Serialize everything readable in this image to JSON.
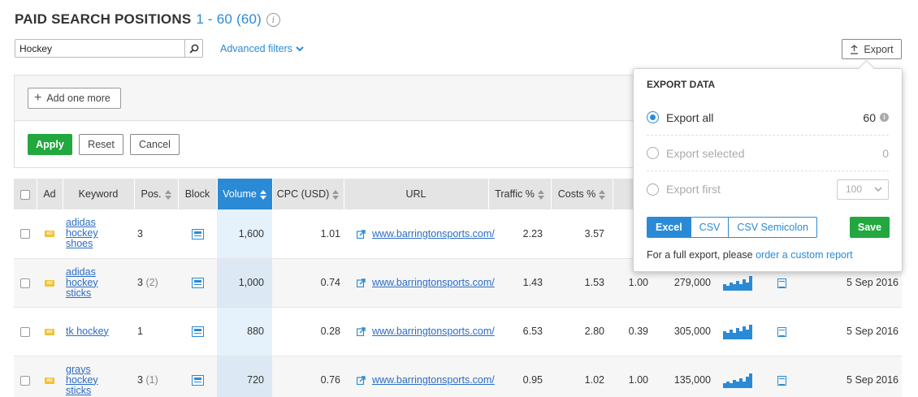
{
  "page": {
    "title": "PAID SEARCH POSITIONS",
    "range": "1 - 60 (60)",
    "info_symbol": "i"
  },
  "search": {
    "value": "Hockey",
    "placeholder": ""
  },
  "advanced_filters_label": "Advanced filters",
  "export_button_label": "Export",
  "filters": {
    "add_more_label": "Add one more",
    "apply_label": "Apply",
    "reset_label": "Reset",
    "cancel_label": "Cancel"
  },
  "table": {
    "headers": {
      "ad": "Ad",
      "keyword": "Keyword",
      "pos": "Pos.",
      "block": "Block",
      "volume": "Volume",
      "cpc": "CPC (USD)",
      "url": "URL",
      "traffic": "Traffic %",
      "costs": "Costs %"
    },
    "rows": [
      {
        "keyword": "adidas hockey shoes",
        "pos": "3",
        "pos_prev": "",
        "volume": "1,600",
        "cpc": "1.01",
        "url": "www.barringtonsports.com/",
        "traffic": "2.23",
        "costs": "3.57",
        "competition": "",
        "results": "",
        "date": ""
      },
      {
        "keyword": "adidas hockey sticks",
        "pos": "3",
        "pos_prev": "(2)",
        "volume": "1,000",
        "cpc": "0.74",
        "url": "www.barringtonsports.com/",
        "traffic": "1.43",
        "costs": "1.53",
        "competition": "1.00",
        "results": "279,000",
        "date": "5 Sep 2016"
      },
      {
        "keyword": "tk hockey",
        "pos": "1",
        "pos_prev": "",
        "volume": "880",
        "cpc": "0.28",
        "url": "www.barringtonsports.com/",
        "traffic": "6.53",
        "costs": "2.80",
        "competition": "0.39",
        "results": "305,000",
        "date": "5 Sep 2016"
      },
      {
        "keyword": "grays hockey sticks",
        "pos": "3",
        "pos_prev": "(1)",
        "volume": "720",
        "cpc": "0.76",
        "url": "www.barringtonsports.com/",
        "traffic": "0.95",
        "costs": "1.02",
        "competition": "1.00",
        "results": "135,000",
        "date": "5 Sep 2016"
      }
    ]
  },
  "export_popup": {
    "heading": "EXPORT DATA",
    "export_all_label": "Export all",
    "export_all_count": "60",
    "export_selected_label": "Export selected",
    "export_selected_count": "0",
    "export_first_label": "Export first",
    "export_first_value": "100",
    "formats": [
      "Excel",
      "CSV",
      "CSV Semicolon"
    ],
    "selected_format": "Excel",
    "save_label": "Save",
    "note_text": "For a full export, please ",
    "note_link": "order a custom report"
  },
  "colors": {
    "accent": "#2b8ad6",
    "green": "#23a73f",
    "ad_badge": "#f1c232"
  }
}
